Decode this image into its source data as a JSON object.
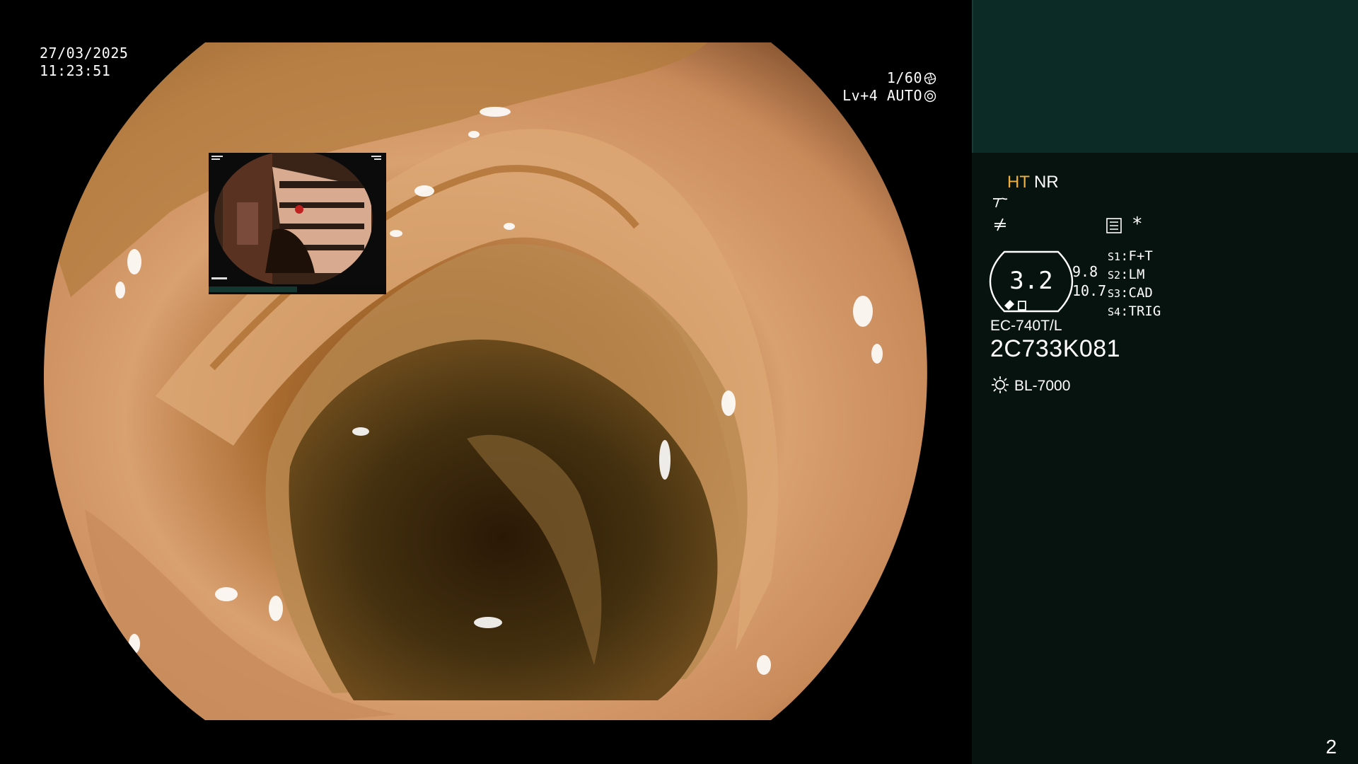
{
  "osd": {
    "date": "27/03/2025",
    "time": "11:23:51",
    "shutter": "1/60",
    "shutter_icon": "aperture-icon",
    "level": "Lv+4",
    "mode": "AUTO",
    "mode_icon": "iris-icon"
  },
  "panel": {
    "ht_label": "HT",
    "nr_label": "NR",
    "mode_icons": [
      "structure-enhance-icon",
      "contrast-icon"
    ],
    "menu_icon": "menu-icon",
    "star": "*",
    "gauge_value": "3.2",
    "side_values": [
      "9.8",
      "10.7"
    ],
    "slots": [
      {
        "key": "S1",
        "value": "F+T"
      },
      {
        "key": "S2",
        "value": "LM"
      },
      {
        "key": "S3",
        "value": "CAD"
      },
      {
        "key": "S4",
        "value": "TRIG"
      }
    ],
    "model": "EC-740T/L",
    "serial": "2C733K081",
    "light_source": "BL-7000",
    "page_number": "2"
  },
  "colors": {
    "panel_top": "#0d2b26",
    "panel_body": "#06130f",
    "ht_active": "#f0b040"
  }
}
